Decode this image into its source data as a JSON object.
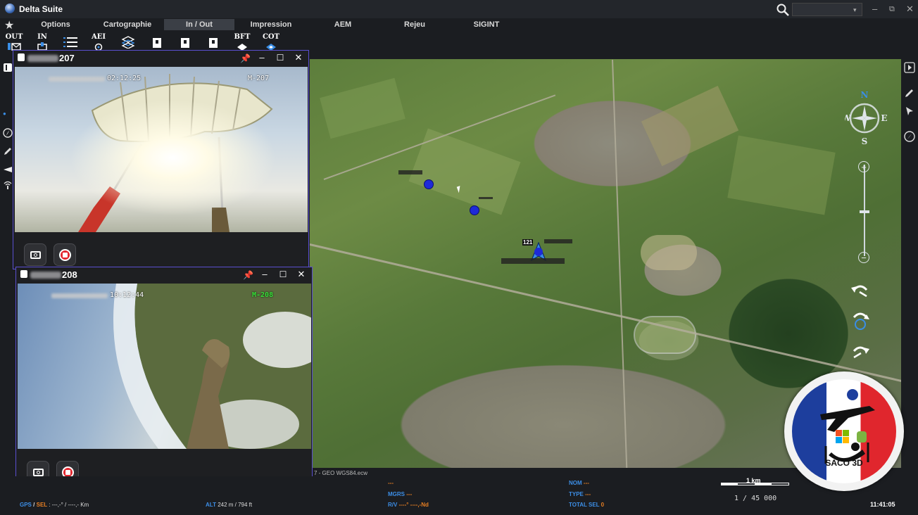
{
  "app": {
    "title": "Delta Suite"
  },
  "menu": {
    "items": [
      {
        "label": "Options"
      },
      {
        "label": "Cartographie"
      },
      {
        "label": "In / Out",
        "active": true
      },
      {
        "label": "Impression"
      },
      {
        "label": "AEM"
      },
      {
        "label": "Rejeu"
      },
      {
        "label": "SIGINT"
      }
    ]
  },
  "toolbar": {
    "buttons": [
      {
        "label": "OUT",
        "icon": "send-out-icon"
      },
      {
        "label": "IN",
        "icon": "receive-in-icon"
      },
      {
        "label": "",
        "icon": "list-icon"
      },
      {
        "label": "AEI",
        "icon": "aei-icon"
      },
      {
        "label": "",
        "icon": "layers-icon"
      },
      {
        "label": "",
        "icon": "export-icon"
      },
      {
        "label": "",
        "icon": "export-icon"
      },
      {
        "label": "",
        "icon": "export-icon"
      },
      {
        "label": "BFT",
        "icon": "bft-icon"
      },
      {
        "label": "COT",
        "icon": "cot-icon"
      }
    ]
  },
  "map": {
    "file_label": "7 - GEO WGS84.ecw",
    "compass": {
      "n": "N",
      "s": "S",
      "e": "E",
      "w": "W"
    },
    "unit_label": "121"
  },
  "video_windows": [
    {
      "title_suffix": "207",
      "osd_time": "02:12:25",
      "osd_id": "M-207",
      "osd_id_color": "#ffffff"
    },
    {
      "title_suffix": "208",
      "osd_time": "10:12:44",
      "osd_id": "M-208",
      "osd_id_color": "#39e039"
    }
  ],
  "status": {
    "gps_key": "GPS",
    "gps_sep": "/",
    "sel_key": "SEL",
    "gps_value": ": ---,-° / ----,- Km",
    "alt_key": "ALT",
    "alt_value": "242 m / 794 ft",
    "top_dash": "---",
    "mgrs_key": "MGRS",
    "mgrs_value": "---",
    "rv_key": "R/V",
    "rv_value": "----° ----,-Nd",
    "nom_key": "NOM",
    "nom_value": "---",
    "type_key": "TYPE",
    "type_value": "---",
    "totalsel_key": "TOTAL SEL",
    "totalsel_value": "0",
    "scale_label": "1 km",
    "scale_ratio": "1 / 45 000",
    "clock": "11:41:05"
  },
  "badge": {
    "text": "SACO 3D",
    "colors": [
      "#1d3e9d",
      "#ffffff",
      "#e0262d"
    ]
  }
}
